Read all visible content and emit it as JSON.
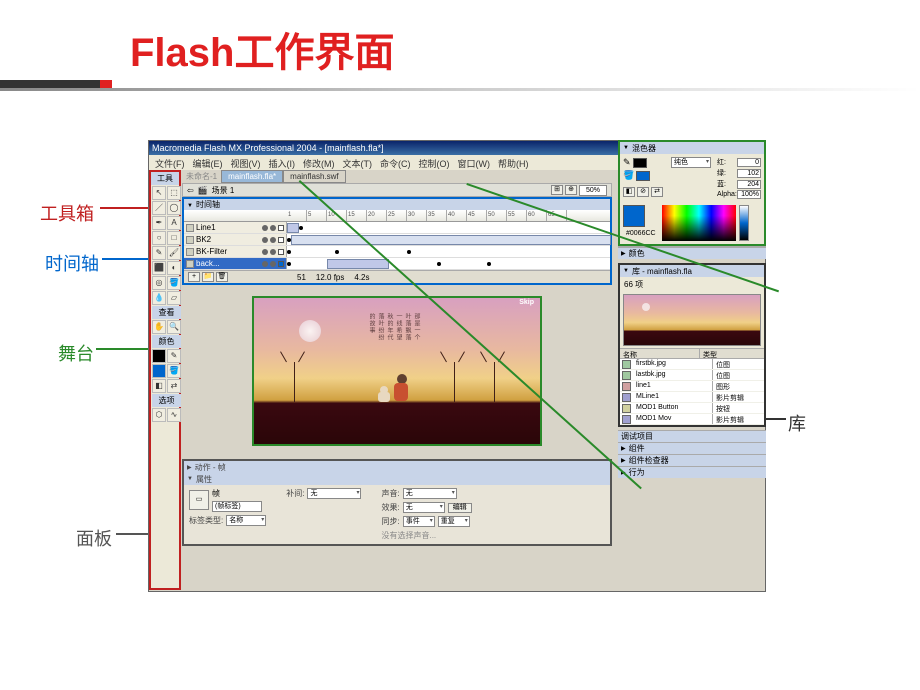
{
  "slide": {
    "title": "Flash工作界面"
  },
  "annotations": {
    "toolbox": "工具箱",
    "timeline": "时间轴",
    "stage": "舞台",
    "panel": "面板",
    "library": "库"
  },
  "titlebar": "Macromedia Flash MX Professional 2004 - [mainflash.fla*]",
  "menu": [
    "文件(F)",
    "编辑(E)",
    "视图(V)",
    "插入(I)",
    "修改(M)",
    "文本(T)",
    "命令(C)",
    "控制(O)",
    "窗口(W)",
    "帮助(H)"
  ],
  "toolbox": {
    "title": "工具",
    "view_label": "查看",
    "color_label": "颜色",
    "opt_label": "选项"
  },
  "doc_tabs": {
    "active": "mainflash.fla*",
    "other": "mainflash.swf"
  },
  "scene_bar": {
    "prefix": "未命名-1",
    "scene": "场景 1",
    "zoom": "50%"
  },
  "timeline": {
    "title": "时间轴",
    "ruler": [
      "1",
      "5",
      "10",
      "15",
      "20",
      "25",
      "30",
      "35",
      "40",
      "45",
      "50",
      "55",
      "60",
      "65"
    ],
    "layers": [
      {
        "name": "Line1"
      },
      {
        "name": "BK2"
      },
      {
        "name": "BK-Filter"
      },
      {
        "name": "back..."
      }
    ],
    "footer": {
      "frame": "51",
      "fps": "12.0 fps",
      "time": "4.2s"
    }
  },
  "panels": {
    "actions_title": "动作 - 帧",
    "props_title": "属性",
    "frame_label_hint": "帧",
    "tag_input": "(帧标签)",
    "tag_type_label": "标签类型:",
    "tag_type_val": "名称",
    "tween_label": "补间:",
    "tween_val": "无",
    "sound_label": "声音:",
    "sound_val": "无",
    "effect_label": "效果:",
    "effect_val": "无",
    "edit_btn": "编辑",
    "sync_label": "同步:",
    "sync_val1": "事件",
    "sync_val2": "重复",
    "sync_hint": "没有选择声音..."
  },
  "mixer": {
    "title": "混色器",
    "type": "纯色",
    "r_label": "红:",
    "r": "0",
    "g_label": "绿:",
    "g": "102",
    "b_label": "蓝:",
    "b": "204",
    "a_label": "Alpha:",
    "a": "100%",
    "hex": "#0066CC"
  },
  "swatches_title": "颜色",
  "library": {
    "title": "库 - mainflash.fla",
    "count": "66 项",
    "col_name": "名称",
    "col_type": "类型",
    "items": [
      {
        "name": "firstbk.jpg",
        "type": "位图",
        "icon": "bmp"
      },
      {
        "name": "lastbk.jpg",
        "type": "位图",
        "icon": "bmp"
      },
      {
        "name": "line1",
        "type": "图形",
        "icon": "gfx"
      },
      {
        "name": "MLine1",
        "type": "影片剪辑",
        "icon": "mc"
      },
      {
        "name": "MOD1 Button",
        "type": "按钮",
        "icon": "btn"
      },
      {
        "name": "MOD1 Mov",
        "type": "影片剪辑",
        "icon": "mc"
      }
    ]
  },
  "bottom_stubs": {
    "p1": "调试项目",
    "p2": "组件",
    "p3": "组件检查器",
    "p4": "行为"
  }
}
